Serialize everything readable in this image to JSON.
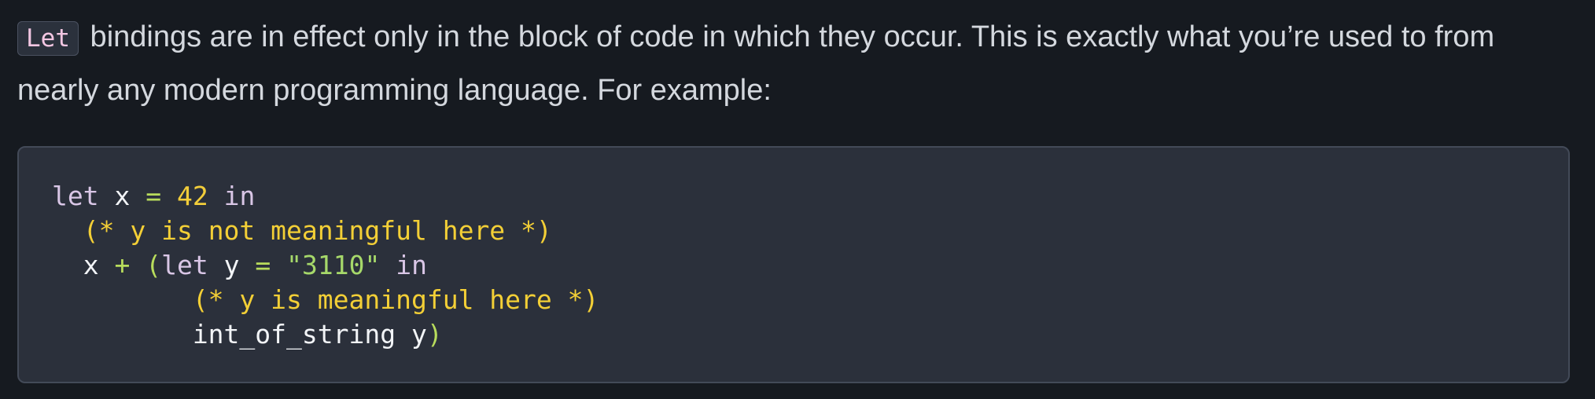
{
  "paragraph": {
    "inline_code": "Let",
    "text": " bindings are in effect only in the block of code in which they occur. This is exactly what you’re used to from nearly any modern programming language. For example:"
  },
  "code": {
    "line1": {
      "kw1": "let",
      "x": "x",
      "eq": "=",
      "num": "42",
      "kw2": "in"
    },
    "line2": {
      "indent": "  ",
      "comment": "(* y is not meaningful here *)"
    },
    "line3": {
      "indent": "  ",
      "x": "x",
      "plus": "+",
      "open": "(",
      "kw1": "let",
      "y": "y",
      "eq": "=",
      "str": "\"3110\"",
      "kw2": "in"
    },
    "line4": {
      "indent": "         ",
      "comment": "(* y is meaningful here *)"
    },
    "line5": {
      "indent": "         ",
      "fn": "int_of_string",
      "y": "y",
      "close": ")"
    }
  }
}
